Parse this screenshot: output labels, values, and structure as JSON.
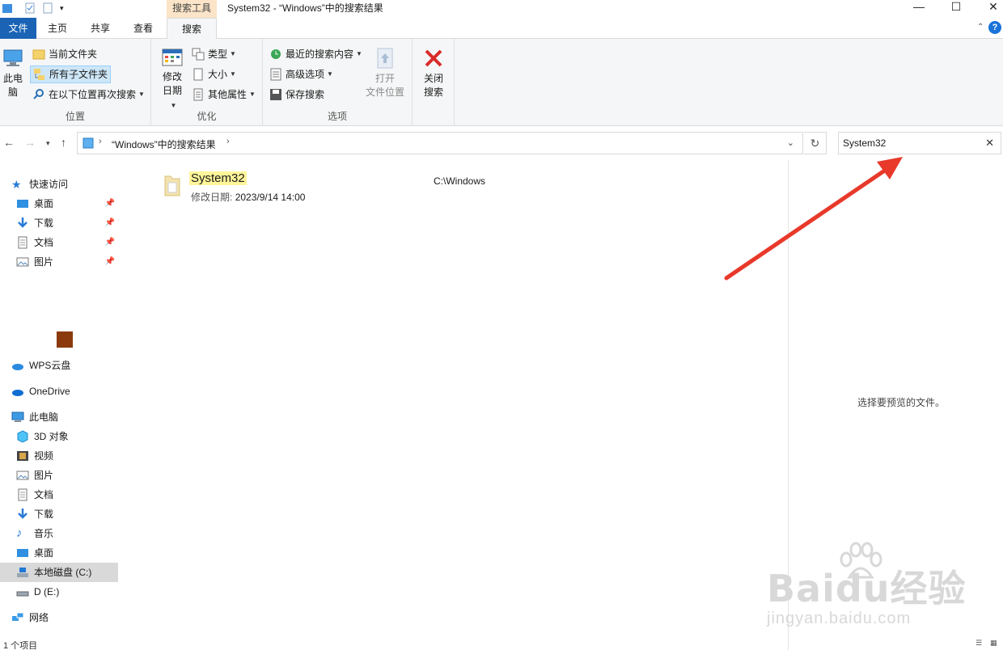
{
  "window": {
    "title": "System32 - “Windows”中的搜索结果",
    "tool_tab_label": "搜索工具",
    "minimize": "—",
    "maximize": "☐",
    "close": "✕"
  },
  "tabs": [
    "文件",
    "主页",
    "共享",
    "查看",
    "搜索"
  ],
  "ribbon": {
    "location": {
      "this_pc": "此电\n脑",
      "current_folder": "当前文件夹",
      "all_subfolders": "所有子文件夹",
      "search_again": "在以下位置再次搜索",
      "label": "位置"
    },
    "refine": {
      "date_modified": "修改\n日期",
      "kind": "类型",
      "size": "大小",
      "other_properties": "其他属性",
      "label": "优化"
    },
    "options": {
      "recent_searches": "最近的搜索内容",
      "advanced_options": "高级选项",
      "save_search": "保存搜索",
      "open_location": "打开\n文件位置",
      "label": "选项"
    },
    "close_search": "关闭\n搜索"
  },
  "address": {
    "path": "“Windows”中的搜索结果",
    "search_value": "System32"
  },
  "nav": {
    "quick_access": "快速访问",
    "qa_items": [
      "桌面",
      "下载",
      "文档",
      "图片"
    ],
    "wps": "WPS云盘",
    "onedrive": "OneDrive",
    "this_pc": "此电脑",
    "pc_items": [
      "3D 对象",
      "视频",
      "图片",
      "文档",
      "下载",
      "音乐",
      "桌面"
    ],
    "local_disk": "本地磁盘 (C:)",
    "d_drive": "D (E:)",
    "network": "网络"
  },
  "result": {
    "name": "System32",
    "meta_label": "修改日期:",
    "meta_value": "2023/9/14 14:00",
    "path": "C:\\Windows"
  },
  "preview": {
    "text": "选择要预览的文件。"
  },
  "status": {
    "count": "1 个项目"
  },
  "watermark": {
    "brand": "Baidu经验",
    "url": "jingyan.baidu.com"
  },
  "colors": {
    "accent": "#1a63b5",
    "highlight": "#fff59a",
    "arrow": "#e8392a"
  }
}
